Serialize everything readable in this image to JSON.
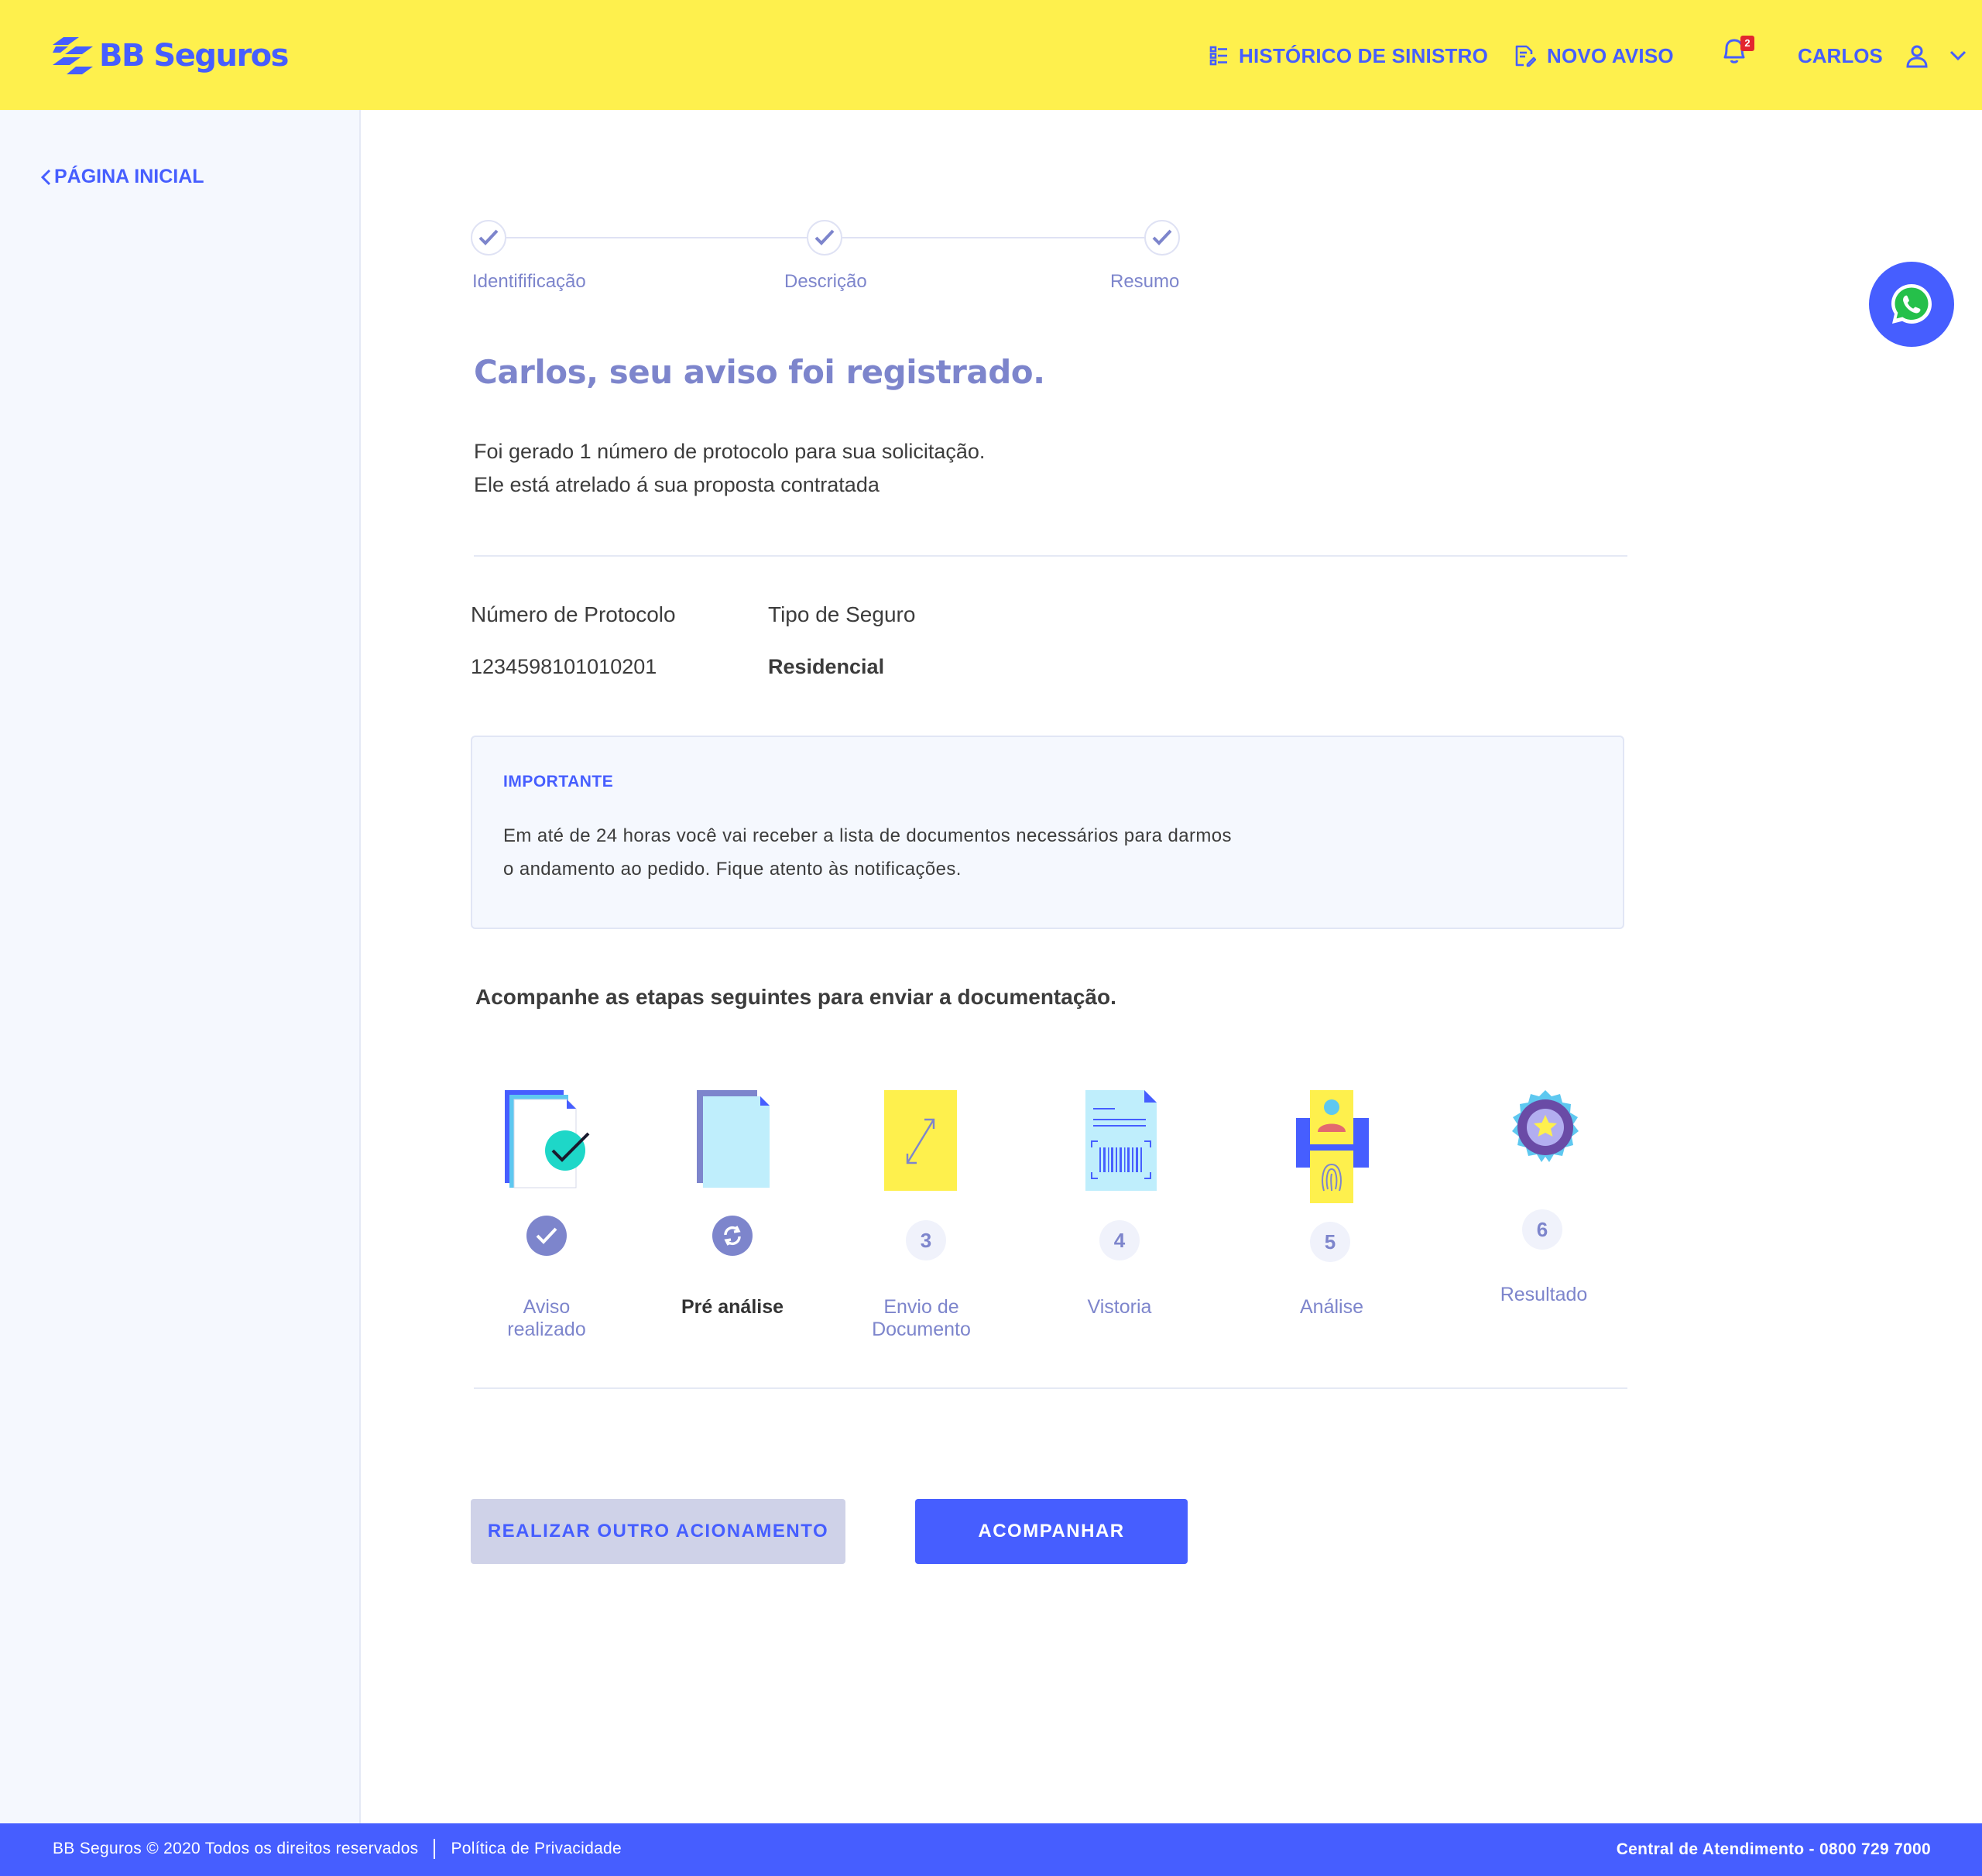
{
  "header": {
    "brand": "BB Seguros",
    "nav": {
      "history_label": "HISTÓRICO DE SINISTRO",
      "new_notice_label": "NOVO AVISO",
      "notification_count": "2",
      "user_name": "CARLOS"
    }
  },
  "sidebar": {
    "back_label": "PÁGINA INICIAL"
  },
  "stepper": {
    "steps": [
      {
        "label": "Identifificação",
        "done": true
      },
      {
        "label": "Descrição",
        "done": true
      },
      {
        "label": "Resumo",
        "done": true
      }
    ]
  },
  "main": {
    "title": "Carlos, seu aviso foi registrado.",
    "intro_line1": "Foi gerado 1 número de protocolo para sua solicitação.",
    "intro_line2": "Ele está atrelado á sua proposta contratada",
    "protocol_label": "Número de Protocolo",
    "protocol_value": "1234598101010201",
    "type_label": "Tipo de Seguro",
    "type_value": "Residencial",
    "notice_title": "IMPORTANTE",
    "notice_line1": "Em até de 24 horas você vai receber a lista de documentos necessários para darmos",
    "notice_line2": "o andamento ao pedido. Fique atento às notificações.",
    "follow_text": "Acompanhe as etapas seguintes para enviar a documentação.",
    "process": [
      {
        "num": "",
        "label_line1": "Aviso",
        "label_line2": "realizado",
        "status": "done"
      },
      {
        "num": "",
        "label_line1": "Pré análise",
        "label_line2": "",
        "status": "in-progress"
      },
      {
        "num": "3",
        "label_line1": "Envio de",
        "label_line2": "Documento",
        "status": "pending"
      },
      {
        "num": "4",
        "label_line1": "Vistoria",
        "label_line2": "",
        "status": "pending"
      },
      {
        "num": "5",
        "label_line1": "Análise",
        "label_line2": "",
        "status": "pending"
      },
      {
        "num": "6",
        "label_line1": "Resultado",
        "label_line2": "",
        "status": "pending"
      }
    ],
    "btn_secondary": "REALIZAR OUTRO ACIONAMENTO",
    "btn_primary": "ACOMPANHAR"
  },
  "footer": {
    "copyright": "BB Seguros © 2020 Todos os direitos reservados",
    "privacy": "Política de Privacidade",
    "contact": "Central de Atendimento - 0800 729 7000"
  },
  "colors": {
    "brand_blue": "#465eff",
    "brand_yellow": "#fef04d",
    "muted_purple": "#7d85cc"
  }
}
